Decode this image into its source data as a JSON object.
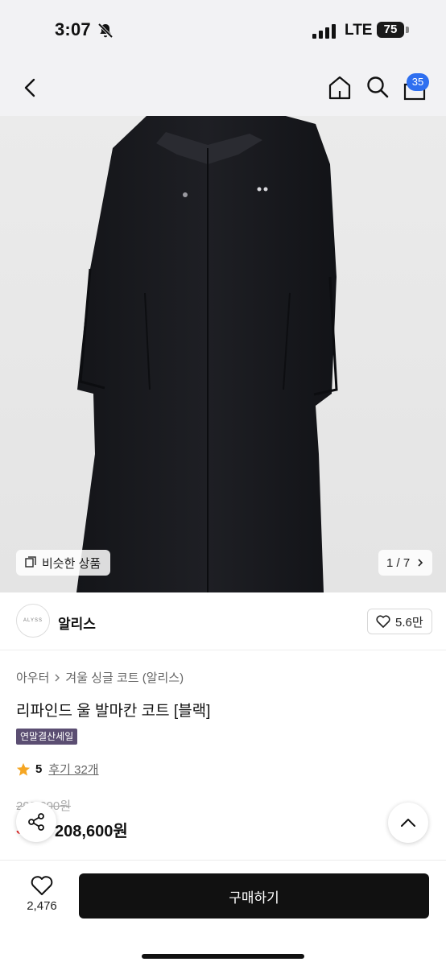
{
  "status": {
    "time": "3:07",
    "network": "LTE",
    "battery": "75"
  },
  "header": {
    "cart_count": "35",
    "icons": [
      "back-icon",
      "home-icon",
      "search-icon",
      "cart-icon"
    ]
  },
  "gallery": {
    "similar_label": "비슷한 상품",
    "pager": "1 / 7"
  },
  "brand": {
    "logo_text": "ALYSS",
    "name": "알리스",
    "likes": "5.6만"
  },
  "product": {
    "breadcrumb": [
      "아우터",
      "겨울 싱글 코트 (알리스)"
    ],
    "title": "리파인드 울 발마칸 코트 [블랙]",
    "sale_tag": "연말결산세일",
    "rating": "5",
    "reviews": "후기 32개",
    "original_price": "298,000원",
    "discount": "30%",
    "price": "208,600원"
  },
  "bottom": {
    "wish_count": "2,476",
    "buy_label": "구매하기"
  },
  "colors": {
    "accent": "#2e6ff0",
    "sale_tag_bg": "#5b4e72",
    "discount": "#e9302f",
    "star": "#f5a623"
  }
}
